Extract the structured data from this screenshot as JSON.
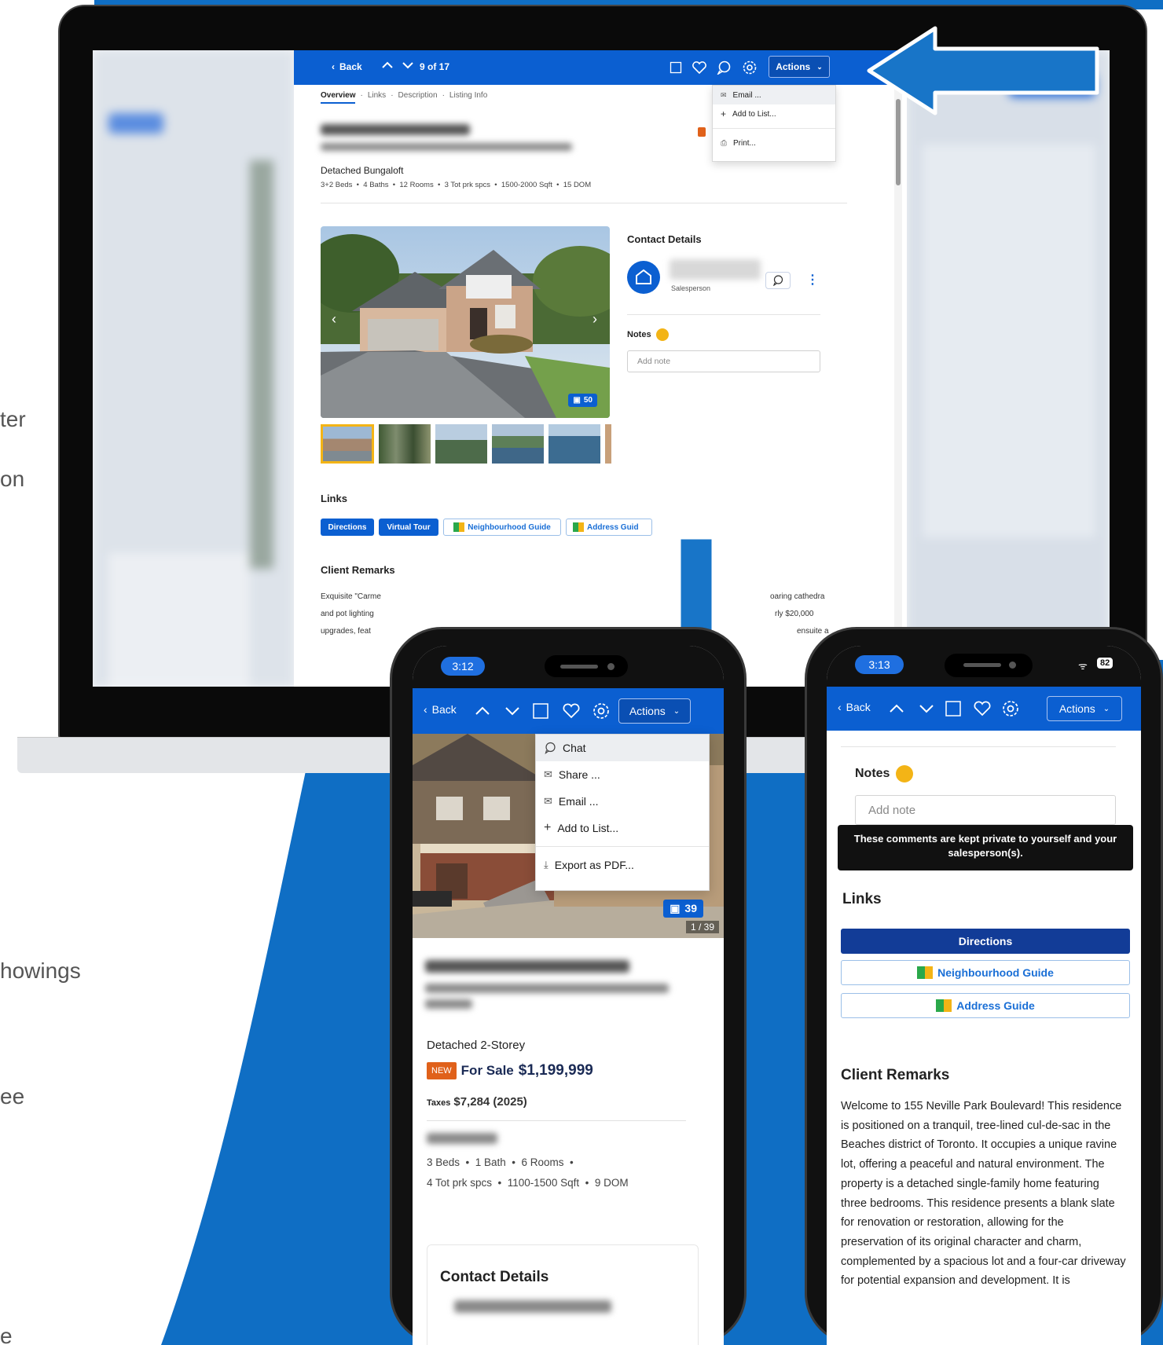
{
  "bg_text": {
    "ter": "ter",
    "on": "on",
    "howings": "howings",
    "ee": "ee",
    "e": "e"
  },
  "desktop": {
    "toolbar": {
      "back": "Back",
      "counter": "9 of 17",
      "actions": "Actions"
    },
    "actions_menu": {
      "email": "Email ...",
      "add_to_list": "Add to List...",
      "print": "Print..."
    },
    "tabs": [
      "Overview",
      "Links",
      "Description",
      "Listing Info"
    ],
    "tab_sep": "·",
    "property_type": "Detached Bungaloft",
    "specs": "3+2 Beds  •  4 Baths  •  12 Rooms  •  3 Tot prk spcs  •  1500-2000 Sqft  •  15 DOM",
    "photo_count": "50",
    "contact": {
      "heading": "Contact Details",
      "role": "Salesperson"
    },
    "notes": {
      "label": "Notes",
      "placeholder": "Add note"
    },
    "links": {
      "heading": "Links",
      "directions": "Directions",
      "virtual_tour": "Virtual Tour",
      "neighbourhood": "Neighbourhood Guide",
      "address": "Address Guid"
    },
    "remarks": {
      "heading": "Client Remarks",
      "line1_left": "Exquisite \"Carme",
      "line1_right": "oaring cathedra",
      "line2_left": "and pot lighting",
      "line2_right": "rly $20,000",
      "line3_left": "upgrades, feat",
      "line3_right": "ensuite a"
    }
  },
  "phone1": {
    "time": "3:12",
    "toolbar": {
      "back": "Back",
      "actions": "Actions"
    },
    "menu": {
      "chat": "Chat",
      "share": "Share ...",
      "email": "Email ...",
      "add_to_list": "Add to List...",
      "export": "Export as PDF..."
    },
    "photo_count": "39",
    "photo_index": "1 / 39",
    "property_type": "Detached 2-Storey",
    "new_badge": "NEW",
    "sale_label": "For Sale",
    "price": "$1,199,999",
    "taxes_label": "Taxes",
    "taxes_value": "$7,284 (2025)",
    "specs_line1": "3 Beds  •  1 Bath  •  6 Rooms  •",
    "specs_line2": "4 Tot prk spcs  •  1100-1500 Sqft  •  9 DOM",
    "contact_heading": "Contact Details"
  },
  "phone2": {
    "time": "3:13",
    "battery": "82",
    "toolbar": {
      "back": "Back",
      "actions": "Actions"
    },
    "notes_label": "Notes",
    "notes_placeholder": "Add note",
    "tooltip": "These comments are kept private to yourself and your salesperson(s).",
    "links_heading": "Links",
    "directions": "Directions",
    "neighbourhood": "Neighbourhood Guide",
    "address": "Address Guide",
    "remarks_heading": "Client Remarks",
    "remarks_text": "Welcome to 155 Neville Park Boulevard! This residence is positioned on a tranquil, tree-lined cul-de-sac in the Beaches district of Toronto. It occupies a unique ravine lot, offering a peaceful and natural environment. The property is a detached single-family home featuring three bedrooms. This residence presents a blank slate for renovation or restoration, allowing for the preservation of its original character and charm, complemented by a spacious lot and a four-car driveway for potential expansion and development. It is"
  },
  "colors": {
    "brand_blue": "#0b5fd1",
    "swoosh_blue": "#0f6ec4",
    "nav_blue": "#123c97",
    "arrow_blue": "#1875c8",
    "new_orange": "#e0611a",
    "notes_yellow": "#f3b416"
  }
}
